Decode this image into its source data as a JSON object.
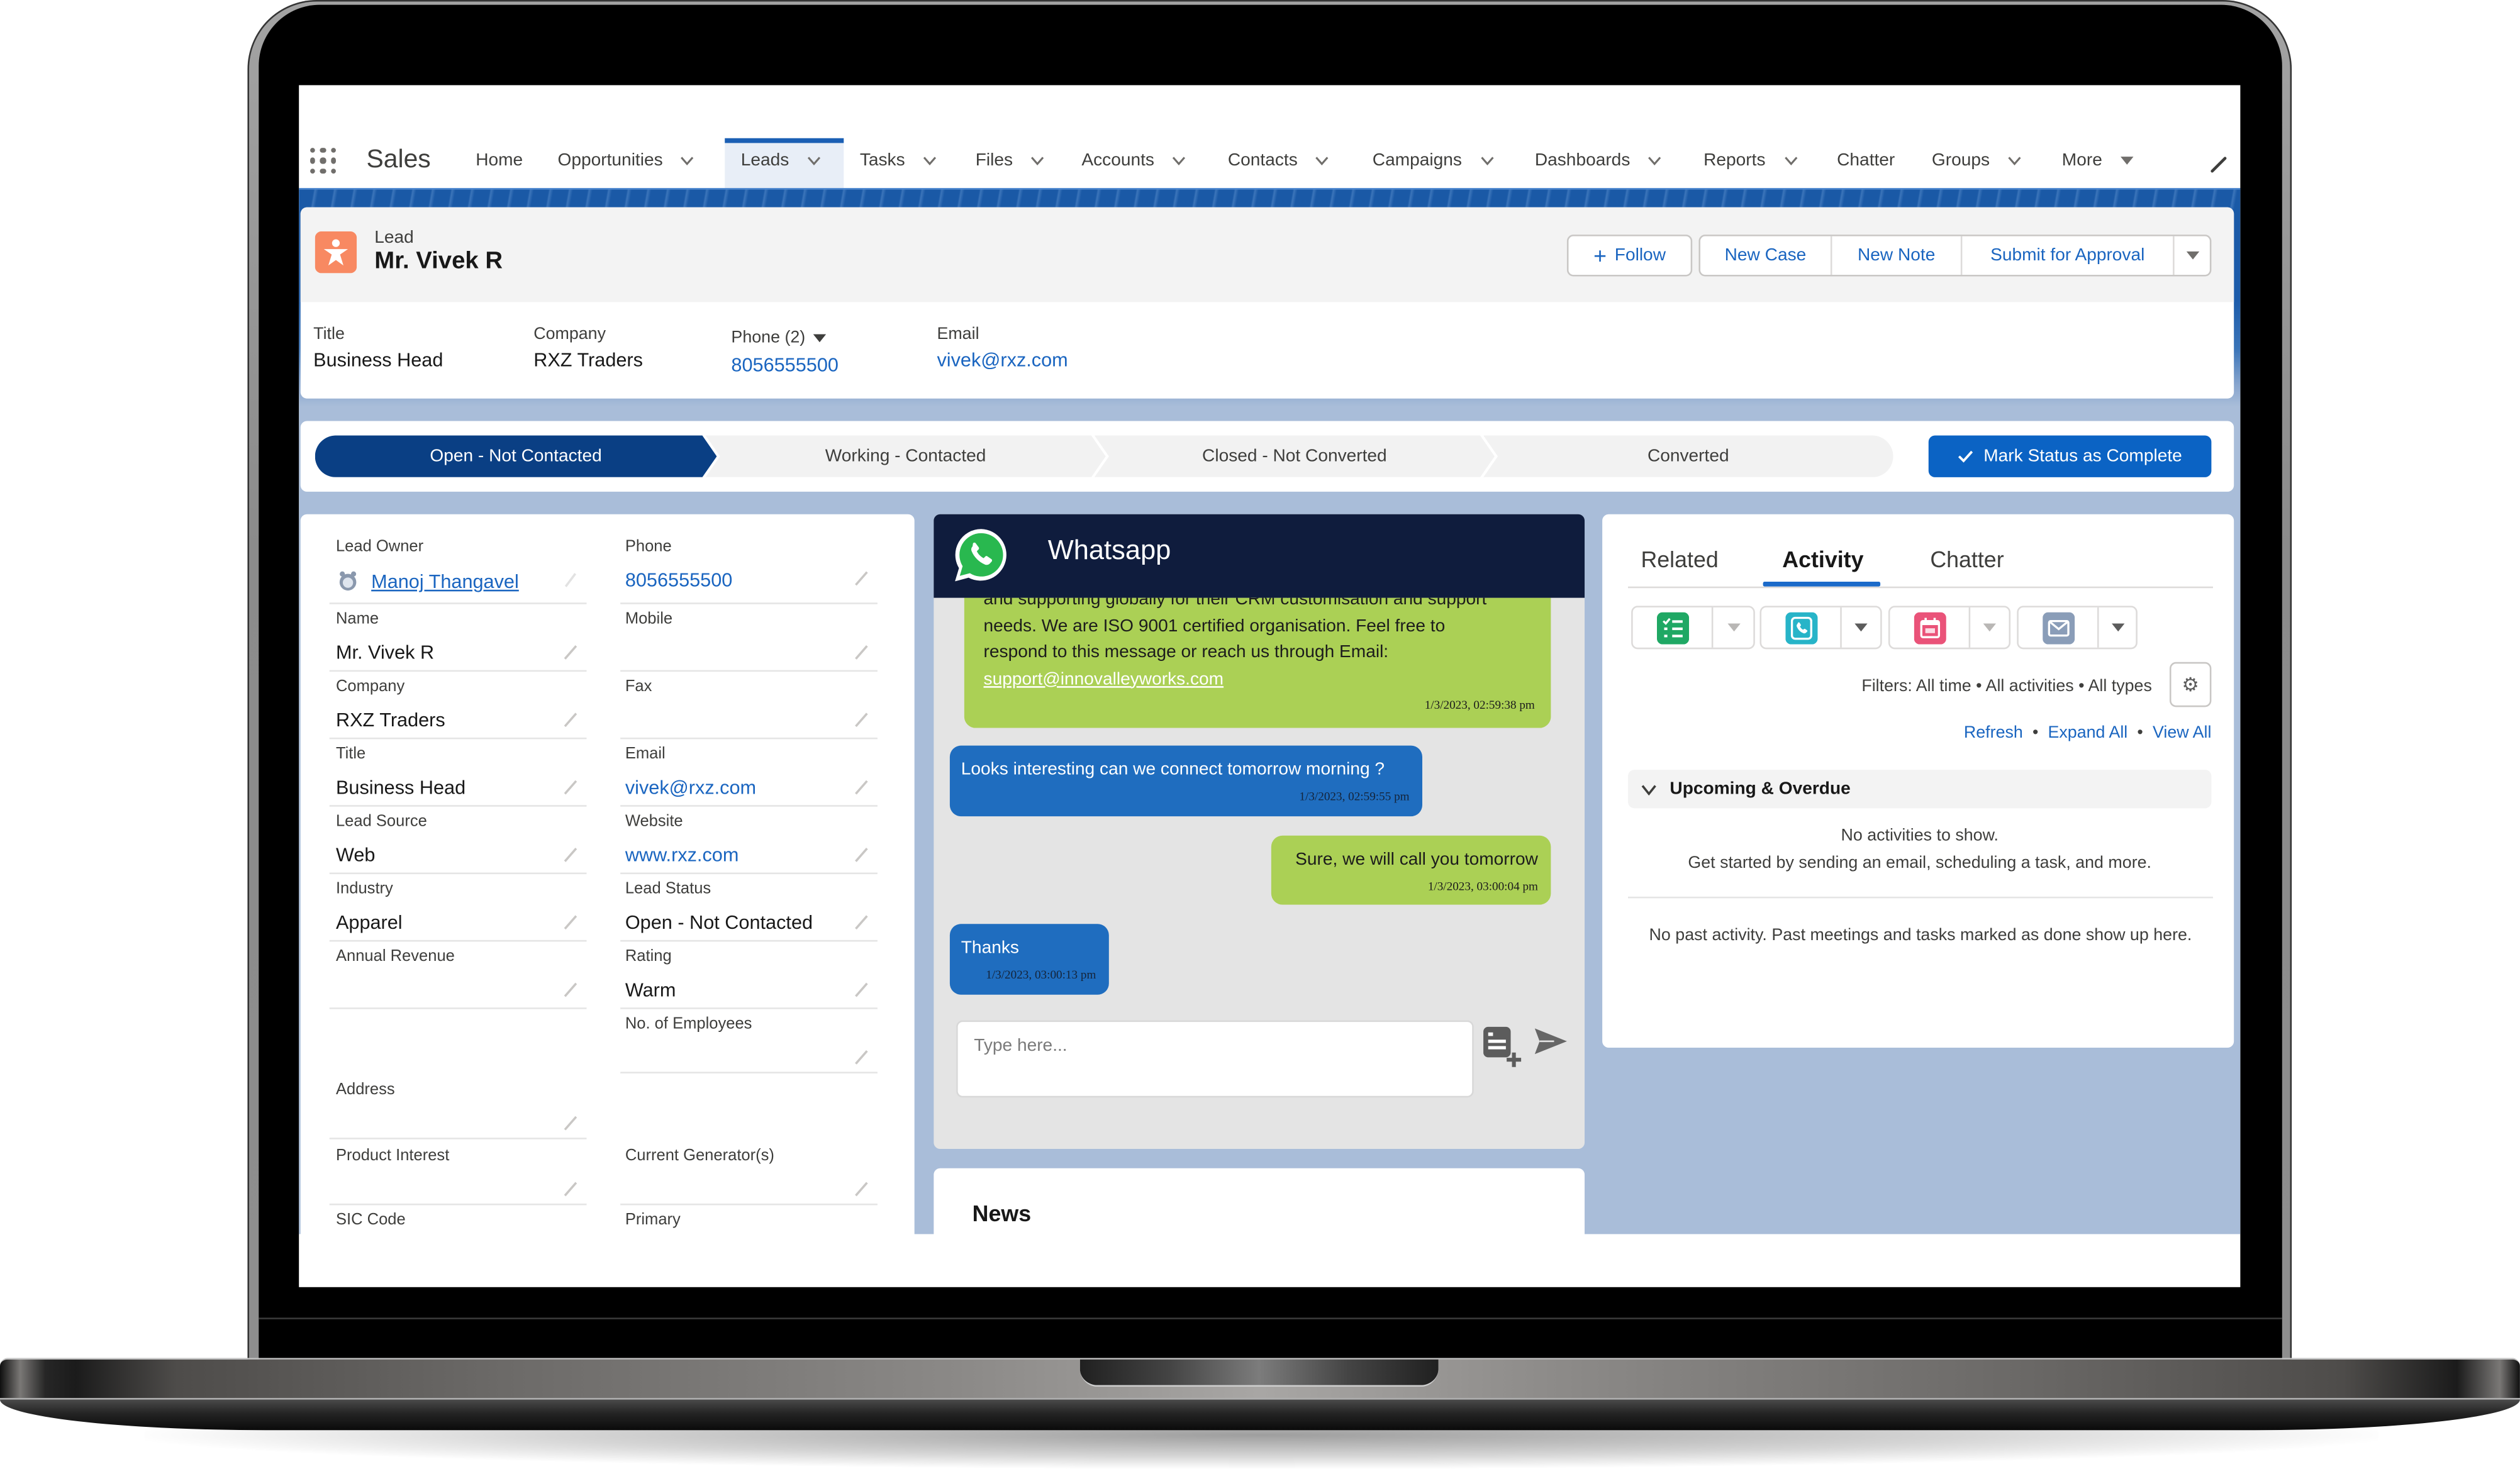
{
  "colors": {
    "link": "#1a65c0",
    "path_active": "#0a3f84",
    "path_inactive": "#f2f2f2",
    "mark_complete": "#0b63c4",
    "whatsapp_header": "#0f1c3d",
    "whatsapp_green": "#29b84f",
    "bubble_outgoing": "#abd055",
    "bubble_incoming": "#1f6dbf",
    "chat_bg": "#e4e4e4",
    "page_bg": "#a9bdd9",
    "lead_icon": "#f88962",
    "task": "#1fa864",
    "call": "#27b4c8",
    "event": "#ea5379",
    "email": "#8a9db8"
  },
  "app": {
    "name": "Sales",
    "launcher_icon": "app-launcher-grid-icon"
  },
  "nav": {
    "items": [
      {
        "label": "Home",
        "menu": false
      },
      {
        "label": "Opportunities",
        "menu": true
      },
      {
        "label": "Leads",
        "menu": true,
        "active": true
      },
      {
        "label": "Tasks",
        "menu": true
      },
      {
        "label": "Files",
        "menu": true
      },
      {
        "label": "Accounts",
        "menu": true
      },
      {
        "label": "Contacts",
        "menu": true
      },
      {
        "label": "Campaigns",
        "menu": true
      },
      {
        "label": "Dashboards",
        "menu": true
      },
      {
        "label": "Reports",
        "menu": true
      },
      {
        "label": "Chatter",
        "menu": false
      },
      {
        "label": "Groups",
        "menu": true
      },
      {
        "label": "More",
        "menu": true
      }
    ],
    "edit_icon": "pencil-icon"
  },
  "record": {
    "object_label": "Lead",
    "name": "Mr. Vivek R",
    "icon": "lead-icon"
  },
  "actions": {
    "follow": "Follow",
    "new_case": "New Case",
    "new_note": "New Note",
    "submit": "Submit for Approval"
  },
  "highlights": {
    "title": {
      "label": "Title",
      "value": "Business Head"
    },
    "company": {
      "label": "Company",
      "value": "RXZ Traders"
    },
    "phone": {
      "label": "Phone (2)",
      "value": "8056555500"
    },
    "email": {
      "label": "Email",
      "value": "vivek@rxz.com"
    }
  },
  "path": {
    "steps": [
      "Open - Not Contacted",
      "Working - Contacted",
      "Closed - Not Converted",
      "Converted"
    ],
    "current_step": "Open - Not Contacted",
    "mark_complete": "Mark Status as Complete"
  },
  "details": {
    "lead_owner": {
      "label": "Lead Owner",
      "value": "Manoj Thangavel"
    },
    "phone": {
      "label": "Phone",
      "value": "8056555500"
    },
    "name": {
      "label": "Name",
      "value": "Mr. Vivek R"
    },
    "mobile": {
      "label": "Mobile",
      "value": ""
    },
    "company": {
      "label": "Company",
      "value": "RXZ Traders"
    },
    "fax": {
      "label": "Fax",
      "value": ""
    },
    "title": {
      "label": "Title",
      "value": "Business Head"
    },
    "email": {
      "label": "Email",
      "value": "vivek@rxz.com"
    },
    "lead_source": {
      "label": "Lead Source",
      "value": "Web"
    },
    "website": {
      "label": "Website",
      "value": "www.rxz.com"
    },
    "industry": {
      "label": "Industry",
      "value": "Apparel"
    },
    "lead_status": {
      "label": "Lead Status",
      "value": "Open - Not Contacted"
    },
    "annual_revenue": {
      "label": "Annual Revenue",
      "value": ""
    },
    "rating": {
      "label": "Rating",
      "value": "Warm"
    },
    "employees": {
      "label": "No. of Employees",
      "value": ""
    },
    "address": {
      "label": "Address",
      "value": ""
    },
    "product_interest": {
      "label": "Product Interest",
      "value": ""
    },
    "current_generators": {
      "label": "Current Generator(s)",
      "value": ""
    },
    "sic_code": {
      "label": "SIC Code",
      "value": ""
    },
    "primary": {
      "label": "Primary",
      "value": ""
    }
  },
  "whatsapp": {
    "title": "Whatsapp",
    "messages": [
      {
        "direction": "outgoing",
        "lines": [
          "and supporting globally for their CRM customisation and support",
          "needs. We are ISO 9001 certified organisation. Feel free to",
          "respond to this message or reach us through Email:"
        ],
        "link": "support@innovalleyworks.com",
        "timestamp": "1/3/2023, 02:59:38 pm"
      },
      {
        "direction": "incoming",
        "text": "Looks interesting can we connect tomorrow morning ?",
        "timestamp": "1/3/2023, 02:59:55 pm"
      },
      {
        "direction": "outgoing",
        "text": "Sure, we will call you tomorrow",
        "timestamp": "1/3/2023, 03:00:04 pm"
      },
      {
        "direction": "incoming",
        "text": "Thanks",
        "timestamp": "1/3/2023, 03:00:13 pm"
      }
    ],
    "input_placeholder": "Type here...",
    "input_value": ""
  },
  "news": {
    "title": "News"
  },
  "activity": {
    "tabs": [
      "Related",
      "Activity",
      "Chatter"
    ],
    "active_tab": "Activity",
    "quick_actions": [
      {
        "icon": "new-task-icon",
        "dropdown_enabled": false
      },
      {
        "icon": "log-call-icon",
        "dropdown_enabled": true
      },
      {
        "icon": "new-event-icon",
        "dropdown_enabled": false
      },
      {
        "icon": "email-icon",
        "dropdown_enabled": true
      }
    ],
    "filters": "Filters: All time • All activities • All types",
    "links": [
      "Refresh",
      "Expand All",
      "View All"
    ],
    "separator": "•",
    "upcoming_title": "Upcoming & Overdue",
    "upcoming_empty": [
      "No activities to show.",
      "Get started by sending an email, scheduling a task, and more."
    ],
    "past_empty": "No past activity. Past meetings and tasks marked as done show up here."
  }
}
